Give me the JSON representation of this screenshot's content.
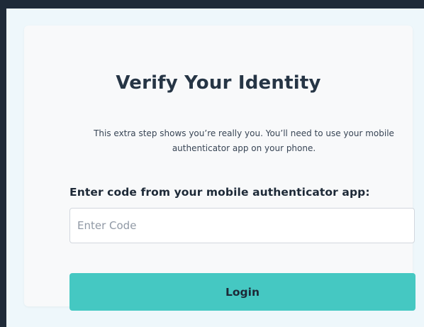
{
  "verify": {
    "title": "Verify Your Identity",
    "description": "This extra step shows you’re really you. You’ll need to use your mobile authenticator app on your phone.",
    "code_label": "Enter code from your mobile authenticator app:",
    "code_input": {
      "value": "",
      "placeholder": "Enter Code"
    },
    "login_label": "Login"
  },
  "colors": {
    "outer_background": "#1e2a38",
    "page_background": "#eef7fb",
    "card_background": "#f8f9fa",
    "accent": "#45c8c2",
    "heading": "#263545"
  }
}
